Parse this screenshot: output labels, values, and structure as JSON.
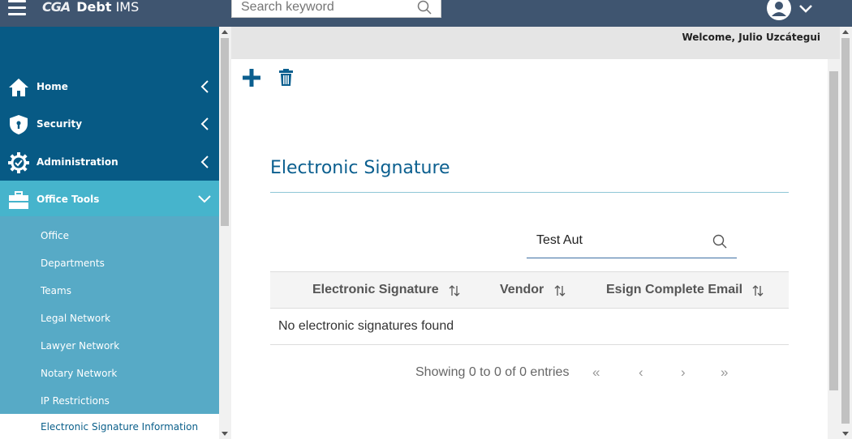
{
  "app": {
    "logo_mark": "CGA",
    "name_bold": "Debt",
    "name_rest": " IMS"
  },
  "topbar": {
    "search_placeholder": "Search keyword"
  },
  "sidebar": {
    "items": [
      {
        "label": "Home",
        "icon": "home-icon"
      },
      {
        "label": "Security",
        "icon": "shield-icon"
      },
      {
        "label": "Administration",
        "icon": "gear-icon"
      },
      {
        "label": "Office Tools",
        "icon": "briefcase-icon"
      }
    ],
    "submenu": [
      "Office",
      "Departments",
      "Teams",
      "Legal Network",
      "Lawyer Network",
      "Notary Network",
      "IP Restrictions",
      "Electronic Signature Information"
    ]
  },
  "welcome": "Welcome, Julio Uzcátegui",
  "main": {
    "title": "Electronic Signature",
    "filter_value": "Test Aut",
    "columns": [
      "Electronic Signature",
      "Vendor",
      "Esign Complete Email"
    ],
    "empty_message": "No electronic signatures found",
    "paging_info": "Showing 0 to 0 of 0 entries",
    "pager": {
      "first": "«",
      "prev": "‹",
      "next": "›",
      "last": "»"
    }
  },
  "colors": {
    "topbar": "#3f5570",
    "sidebar": "#075a85",
    "sidebar_active": "#46b4cc",
    "submenu": "#57aac6",
    "accent": "#0b5f8f"
  }
}
